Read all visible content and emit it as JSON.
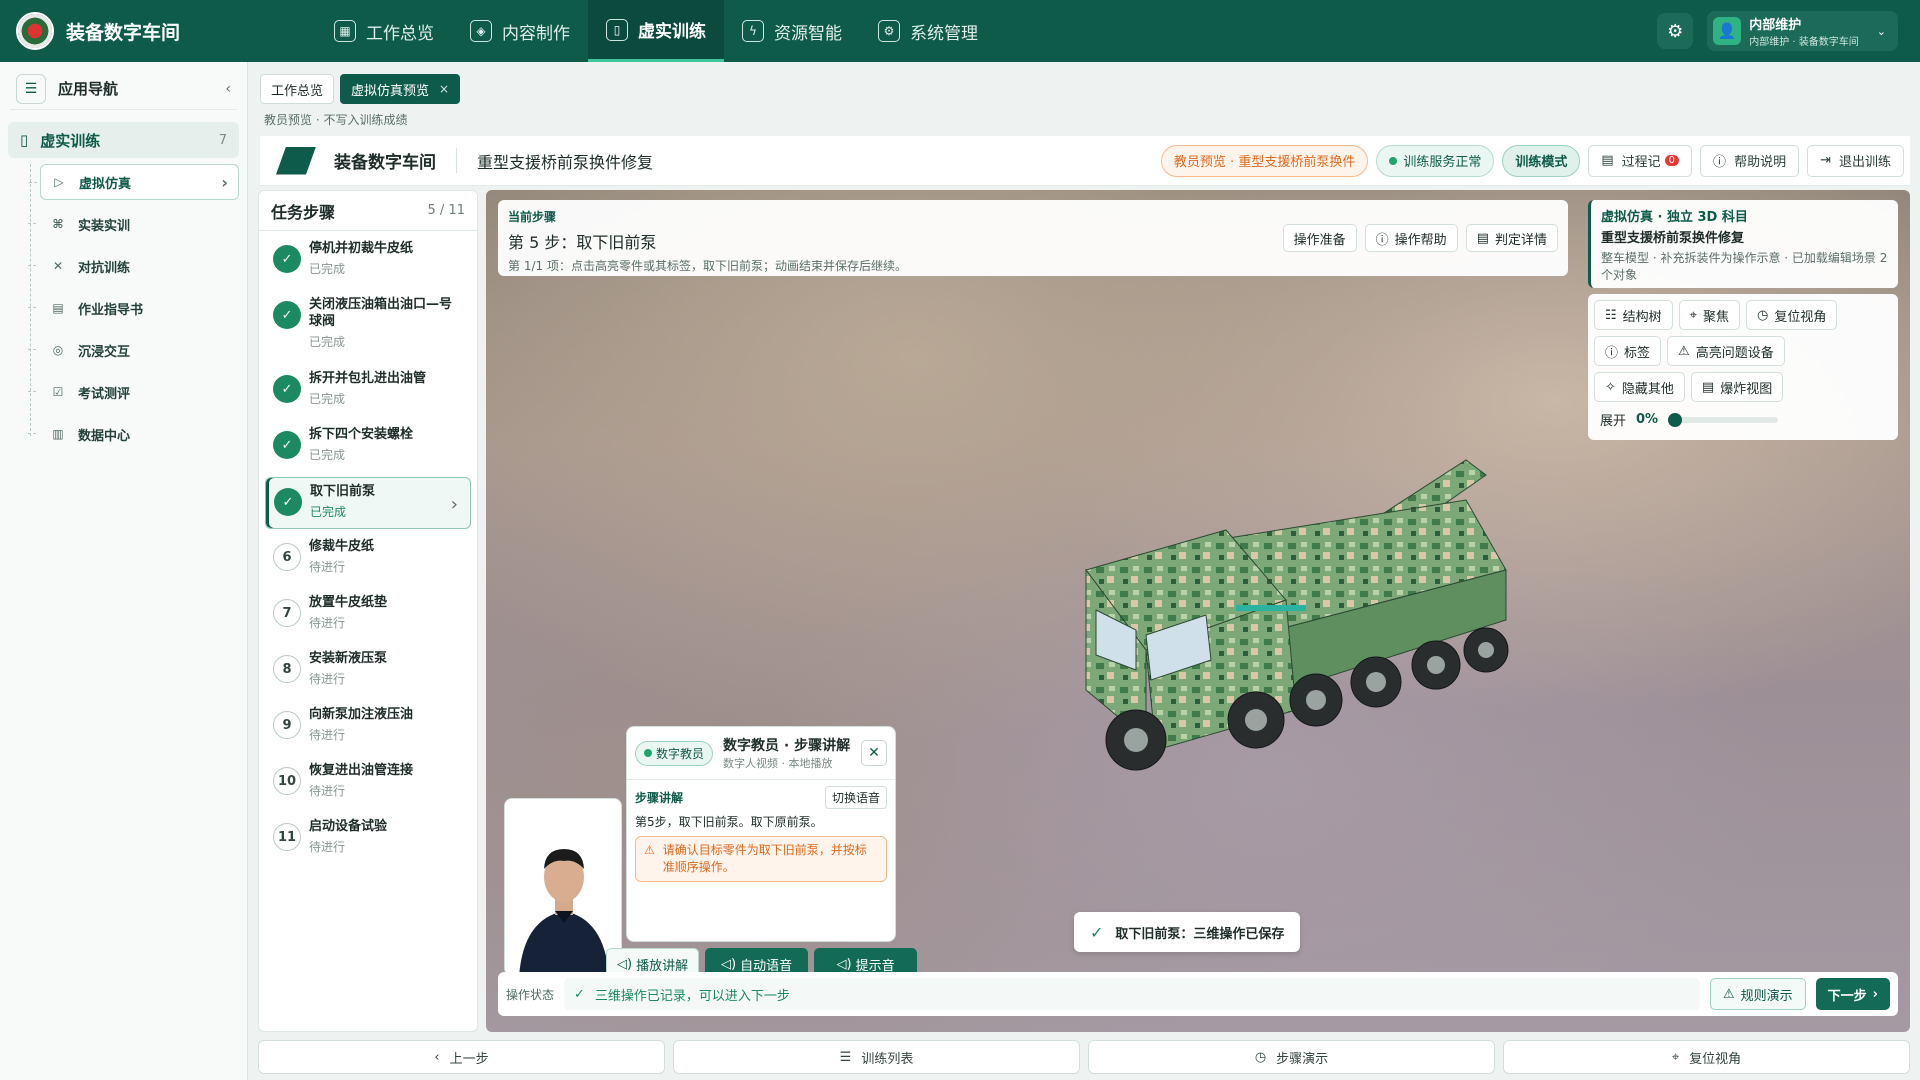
{
  "app": {
    "brand": "装备数字车间"
  },
  "topnav": [
    {
      "label": "工作总览",
      "icon": "grid-icon",
      "active": false
    },
    {
      "label": "内容制作",
      "icon": "cube-icon",
      "active": false
    },
    {
      "label": "虚实训练",
      "icon": "book-icon",
      "active": true
    },
    {
      "label": "资源智能",
      "icon": "plug-icon",
      "active": false
    },
    {
      "label": "系统管理",
      "icon": "gear-icon",
      "active": false
    }
  ],
  "user": {
    "name": "内部维护",
    "sub": "内部维护 · 装备数字车间"
  },
  "sidebar": {
    "title": "应用导航",
    "group": {
      "label": "虚实训练",
      "count": "7"
    },
    "items": [
      {
        "label": "虚拟仿真",
        "icon": "▷"
      },
      {
        "label": "实装实训",
        "icon": "⌘"
      },
      {
        "label": "对抗训练",
        "icon": "✕"
      },
      {
        "label": "作业指导书",
        "icon": "▤"
      },
      {
        "label": "沉浸交互",
        "icon": "◎"
      },
      {
        "label": "考试测评",
        "icon": "☑"
      },
      {
        "label": "数据中心",
        "icon": "▥"
      }
    ]
  },
  "tabs": [
    {
      "label": "工作总览"
    },
    {
      "label": "虚拟仿真预览",
      "close": "×"
    }
  ],
  "preview_note": "教员预览 · 不写入训练成绩",
  "header": {
    "brand": "装备数字车间",
    "title": "重型支援桥前泵换件修复",
    "warn_chip": "教员预览 · 重型支援桥前泵换件",
    "service_chip": "训练服务正常",
    "mode_chip": "训练模式",
    "log_btn": "过程记",
    "log_badge": "0",
    "help_btn": "帮助说明",
    "exit_btn": "退出训练"
  },
  "steps": {
    "title": "任务步骤",
    "count": "5 / 11",
    "items": [
      {
        "num": "✓",
        "name": "停机并初裁牛皮纸",
        "status": "已完成"
      },
      {
        "num": "✓",
        "name": "关闭液压油箱出油口—号球阀",
        "status": "已完成"
      },
      {
        "num": "✓",
        "name": "拆开并包扎进出油管",
        "status": "已完成"
      },
      {
        "num": "✓",
        "name": "拆下四个安装螺栓",
        "status": "已完成"
      },
      {
        "num": "✓",
        "name": "取下旧前泵",
        "status": "已完成"
      },
      {
        "num": "6",
        "name": "修裁牛皮纸",
        "status": "待进行"
      },
      {
        "num": "7",
        "name": "放置牛皮纸垫",
        "status": "待进行"
      },
      {
        "num": "8",
        "name": "安装新液压泵",
        "status": "待进行"
      },
      {
        "num": "9",
        "name": "向新泵加注液压油",
        "status": "待进行"
      },
      {
        "num": "10",
        "name": "恢复进出油管连接",
        "status": "待进行"
      },
      {
        "num": "11",
        "name": "启动设备试验",
        "status": "待进行"
      }
    ]
  },
  "current_step": {
    "label": "当前步骤",
    "title": "第 5 步：取下旧前泵",
    "desc": "第 1/1 项：点击高亮零件或其标签，取下旧前泵；动画结束并保存后继续。",
    "btn_prepare": "操作准备",
    "btn_help": "操作帮助",
    "btn_detail": "判定详情"
  },
  "info_card": {
    "l1": "虚拟仿真 · 独立 3D 科目",
    "l2": "重型支援桥前泵换件修复",
    "l3": "整车模型 · 补充拆装件为操作示意 · 已加载编辑场景 2 个对象"
  },
  "tools": {
    "tree": "结构树",
    "focus": "聚焦",
    "reset_view": "复位视角",
    "label": "标签",
    "highlight": "高亮问题设备",
    "hide_others": "隐藏其他",
    "explode": "爆炸视图",
    "expand_label": "展开",
    "expand_value": "0%"
  },
  "instructor": {
    "badge": "数字教员",
    "title": "数字教员 · 步骤讲解",
    "sub": "数字人视频 · 本地播放",
    "section": "步骤讲解",
    "switch": "切换语音",
    "text": "第5步，取下旧前泵。取下原前泵。",
    "warn": "请确认目标零件为取下旧前泵，并按标准顺序操作。",
    "btn_play": "播放讲解",
    "btn_auto": "自动语音",
    "btn_tone": "提示音"
  },
  "toast": {
    "text": "取下旧前泵：三维操作已保存"
  },
  "opbar": {
    "label": "操作状态",
    "status": "三维操作已记录，可以进入下一步",
    "rule_btn": "规则演示",
    "next_btn": "下一步"
  },
  "bottombar": {
    "prev": "上一步",
    "list": "训练列表",
    "demo": "步骤演示",
    "reset": "复位视角"
  }
}
